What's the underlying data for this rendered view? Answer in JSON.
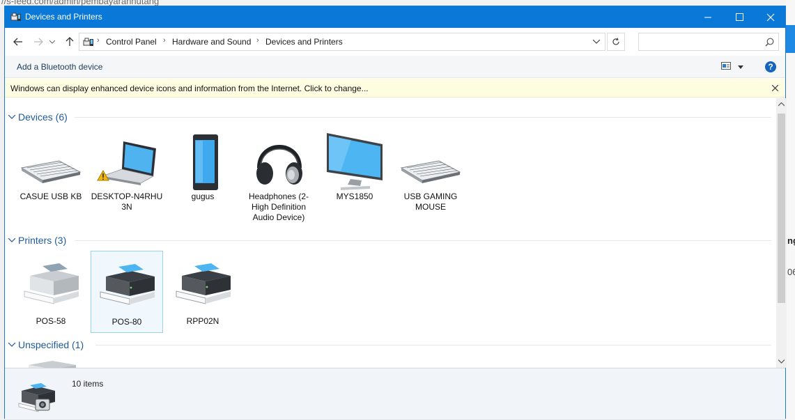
{
  "background": {
    "url_fragment": "//s-feed.com/admin/pembayaranhutang",
    "right_text_1": "ng",
    "right_text_2": "06"
  },
  "window": {
    "title": "Devices and Printers",
    "controls": [
      "minimize",
      "maximize",
      "close"
    ]
  },
  "address": {
    "breadcrumbs": [
      "Control Panel",
      "Hardware and Sound",
      "Devices and Printers"
    ],
    "search_placeholder": ""
  },
  "commandbar": {
    "add_bluetooth": "Add a Bluetooth device",
    "help": "?"
  },
  "infobar": {
    "message": "Windows can display enhanced device icons and information from the Internet. Click to change..."
  },
  "groups": {
    "devices": {
      "title": "Devices (6)",
      "items": [
        {
          "label": "CASUE USB KB",
          "icon": "keyboard-icon"
        },
        {
          "label": "DESKTOP-N4RHU 3N",
          "icon": "laptop-warning-icon"
        },
        {
          "label": "gugus",
          "icon": "phone-icon"
        },
        {
          "label": "Headphones (2- High Definition Audio Device)",
          "icon": "headphones-icon"
        },
        {
          "label": "MYS1850",
          "icon": "monitor-icon"
        },
        {
          "label": "USB GAMING MOUSE",
          "icon": "keyboard-icon"
        }
      ]
    },
    "printers": {
      "title": "Printers (3)",
      "items": [
        {
          "label": "POS-58",
          "icon": "printer-gray-icon"
        },
        {
          "label": "POS-80",
          "icon": "printer-icon",
          "selected": true
        },
        {
          "label": "RPP02N",
          "icon": "printer-icon"
        }
      ]
    },
    "unspecified": {
      "title": "Unspecified (1)"
    }
  },
  "details": {
    "count": "10 items"
  },
  "colors": {
    "titlebar": "#0a78d7",
    "group_heading": "#1e5b9a",
    "infobar": "#fffde1",
    "selection_border": "#99d1f0"
  }
}
